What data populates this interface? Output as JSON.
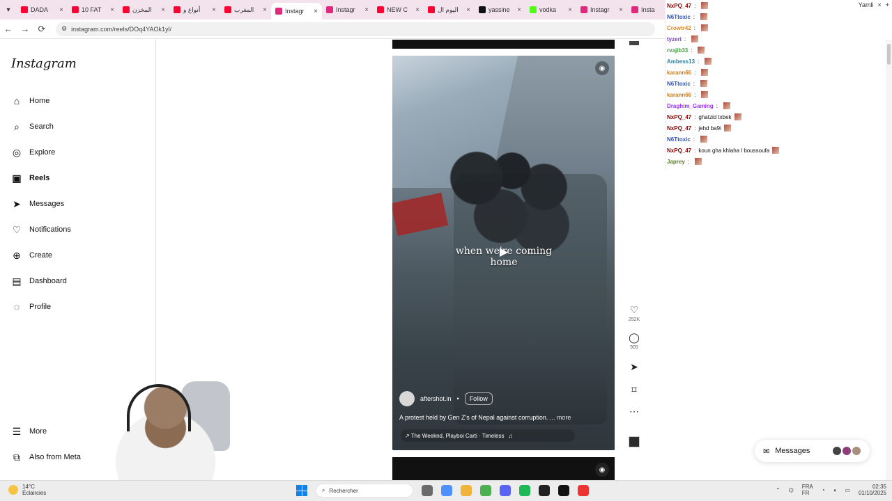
{
  "browser": {
    "tabs": [
      {
        "label": "DADA",
        "color": "#ff0033"
      },
      {
        "label": "10 FAT",
        "color": "#ff0033"
      },
      {
        "label": "المخزن",
        "color": "#ff0033"
      },
      {
        "label": "أنواع و",
        "color": "#ff0033"
      },
      {
        "label": "المغرب",
        "color": "#ff0033"
      },
      {
        "label": "Instagr",
        "color": "#dd2a7b"
      },
      {
        "label": "Instagr",
        "color": "#dd2a7b"
      },
      {
        "label": "NEW C",
        "color": "#ff0033"
      },
      {
        "label": "اليوم ال",
        "color": "#ff0033"
      },
      {
        "label": "yassine",
        "color": "#111111"
      },
      {
        "label": "vodka",
        "color": "#53fc18"
      },
      {
        "label": "Instagr",
        "color": "#dd2a7b"
      },
      {
        "label": "Insta",
        "color": "#dd2a7b"
      }
    ],
    "url": "instagram.com/reels/DOq4YAOk1yl/",
    "extra_tab": "Yamli"
  },
  "sidebar": {
    "logo": "Instagram",
    "items": [
      {
        "label": "Home",
        "icon": "home-icon"
      },
      {
        "label": "Search",
        "icon": "search-icon"
      },
      {
        "label": "Explore",
        "icon": "explore-icon"
      },
      {
        "label": "Reels",
        "icon": "reels-icon"
      },
      {
        "label": "Messages",
        "icon": "messages-icon"
      },
      {
        "label": "Notifications",
        "icon": "heart-icon"
      },
      {
        "label": "Create",
        "icon": "plus-icon"
      },
      {
        "label": "Dashboard",
        "icon": "dashboard-icon"
      },
      {
        "label": "Profile",
        "icon": "profile-icon"
      }
    ],
    "bottom": [
      {
        "label": "More",
        "icon": "menu-icon"
      },
      {
        "label": "Also from Meta",
        "icon": "meta-icon"
      }
    ]
  },
  "reel": {
    "overlay_text": "when we're coming home",
    "account": "aftershot.in",
    "follow_label": "Follow",
    "description": "A protest held by Gen Z's of Nepal against corruption.",
    "more_label": "... more",
    "music": "↗ The Weeknd, Playboi Carti · Timeless",
    "likes": "252K",
    "comments": "905"
  },
  "chat": [
    {
      "user": "NxPQ_47",
      "text": "",
      "color": "#8b0000"
    },
    {
      "user": "N6Ttoxic",
      "text": "",
      "color": "#2a52be"
    },
    {
      "user": "Crowtr42",
      "text": "",
      "color": "#d98c2b"
    },
    {
      "user": "tyzeri",
      "text": "",
      "color": "#7b3fbf"
    },
    {
      "user": "rvajib33",
      "text": "",
      "color": "#40a040"
    },
    {
      "user": "Ambess13",
      "text": "",
      "color": "#2e7f9f"
    },
    {
      "user": "karann66",
      "text": "",
      "color": "#c47f2c"
    },
    {
      "user": "N6Ttoxic",
      "text": "",
      "color": "#2a52be"
    },
    {
      "user": "karann66",
      "text": "",
      "color": "#c47f2c"
    },
    {
      "user": "Draghim_Gaming",
      "text": "",
      "color": "#9b30ff"
    },
    {
      "user": "NxPQ_47",
      "text": "ghatzid txbek",
      "color": "#8b0000"
    },
    {
      "user": "NxPQ_47",
      "text": "jehd ba9i",
      "color": "#8b0000"
    },
    {
      "user": "N6Ttoxic",
      "text": "",
      "color": "#2a52be"
    },
    {
      "user": "NxPQ_47",
      "text": "koun gha khlaha l boussoufa",
      "color": "#8b0000"
    },
    {
      "user": "Japrey",
      "text": "",
      "color": "#5d7b2c"
    }
  ],
  "messages_pill": {
    "label": "Messages"
  },
  "taskbar": {
    "temp": "14°C",
    "weather": "Éclaircies",
    "search_placeholder": "Rechercher",
    "lang_1": "FRA",
    "lang_2": "FR",
    "time": "02:35",
    "date": "01/10/2025"
  }
}
